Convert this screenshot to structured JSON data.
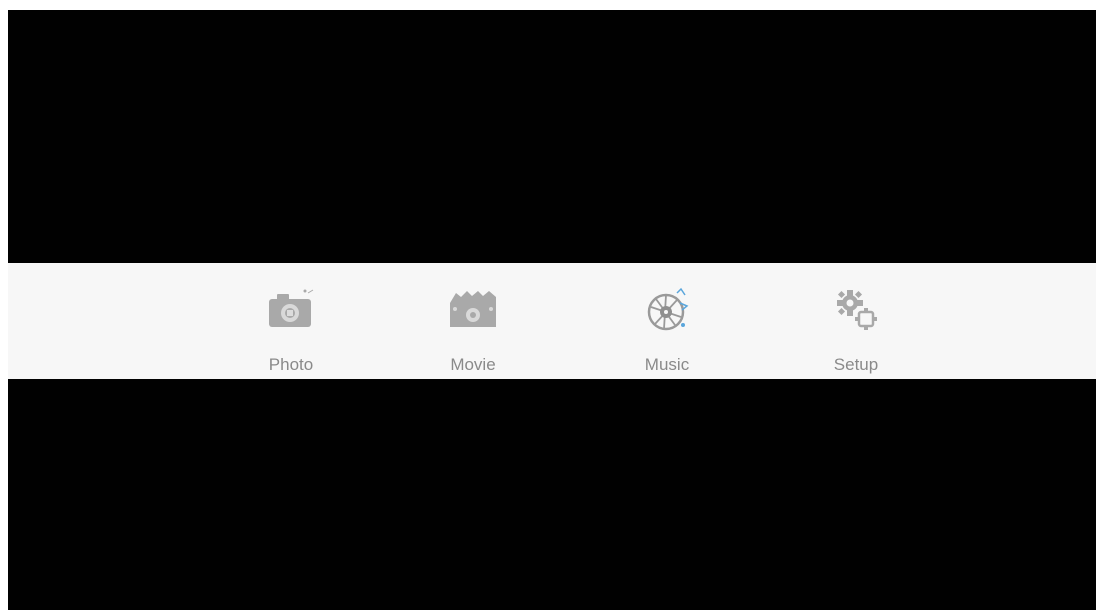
{
  "main_menu": {
    "items": [
      {
        "label": "Photo",
        "icon": "camera-icon",
        "selected": false
      },
      {
        "label": "Movie",
        "icon": "clapperboard-icon",
        "selected": false
      },
      {
        "label": "Music",
        "icon": "music-disc-icon",
        "selected": true
      },
      {
        "label": "Setup",
        "icon": "gears-icon",
        "selected": false
      }
    ]
  },
  "colors": {
    "screen_background": "#010101",
    "menu_bar_background": "#f7f7f7",
    "icon_gray": "#a9a9a9",
    "label_gray": "#8a8a8a",
    "selected_accent": "#5aa6dc"
  }
}
